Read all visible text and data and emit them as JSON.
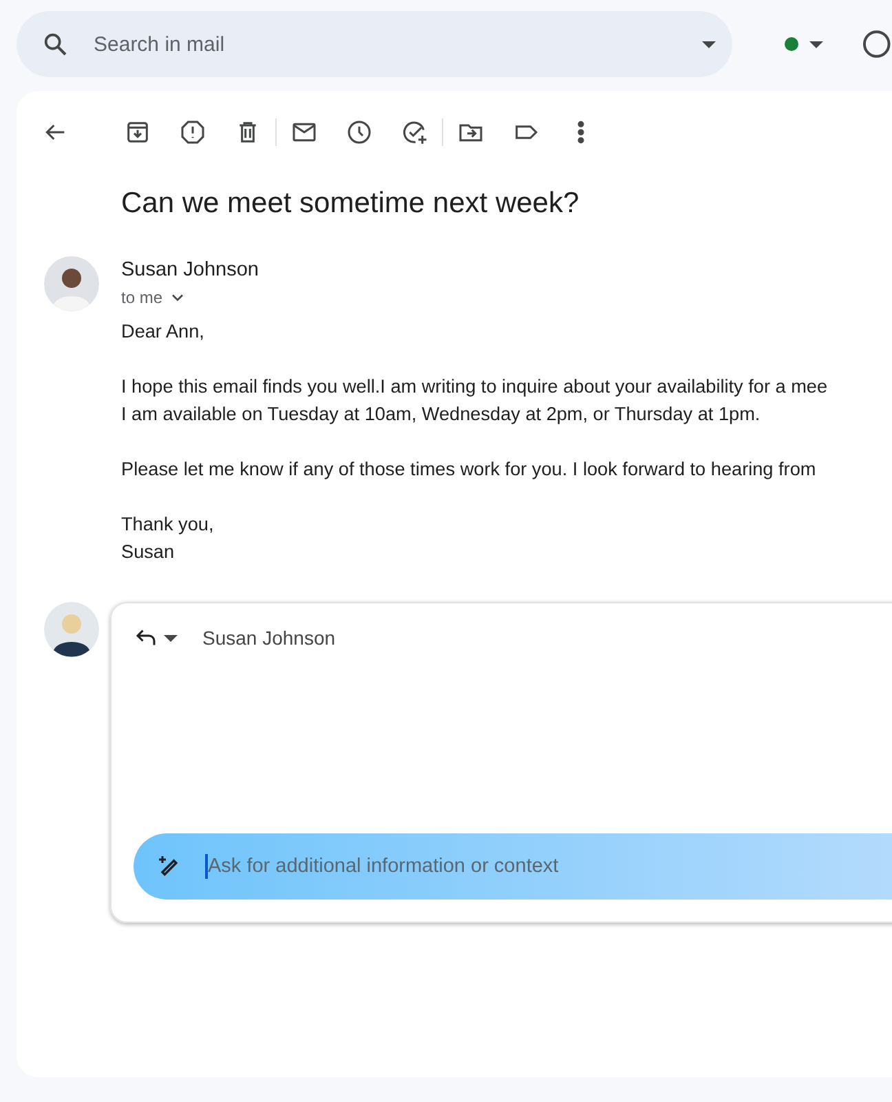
{
  "search": {
    "placeholder": "Search in mail"
  },
  "email": {
    "subject": "Can we meet sometime next week?",
    "sender": "Susan Johnson",
    "recipient": "to me",
    "body": [
      [
        "Dear Ann,"
      ],
      [
        "I hope this email finds you well.I am writing to inquire about your availability for a mee",
        "I am available on Tuesday at 10am, Wednesday at 2pm, or Thursday at 1pm."
      ],
      [
        "Please let me know if any of those times work for you. I look forward to hearing from"
      ],
      [
        "Thank you,",
        "Susan"
      ]
    ]
  },
  "reply": {
    "recipient": "Susan Johnson",
    "ai_prompt": {
      "placeholder": "Ask for additional information or context"
    }
  }
}
